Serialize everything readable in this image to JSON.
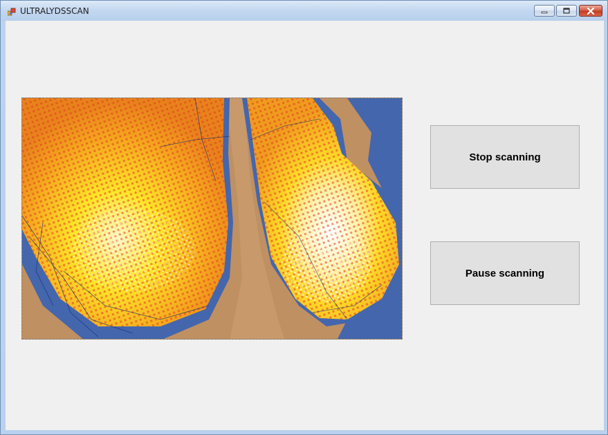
{
  "window": {
    "title": "ULTRALYDSSCAN",
    "app_icon": "app-icon",
    "controls": {
      "minimize_icon": "minimize-icon",
      "maximize_icon": "maximize-icon",
      "close_icon": "close-icon"
    }
  },
  "scan_view": {
    "content": "ultrasound-scan-render",
    "colors": {
      "background": "#4466ad",
      "skin": "#bf9062",
      "points_hot": "#ffe21a",
      "points_mid": "#f6a21c",
      "points_edge": "#e23b1e",
      "points_peak": "#ffffff"
    }
  },
  "buttons": {
    "stop_label": "Stop scanning",
    "pause_label": "Pause scanning"
  }
}
